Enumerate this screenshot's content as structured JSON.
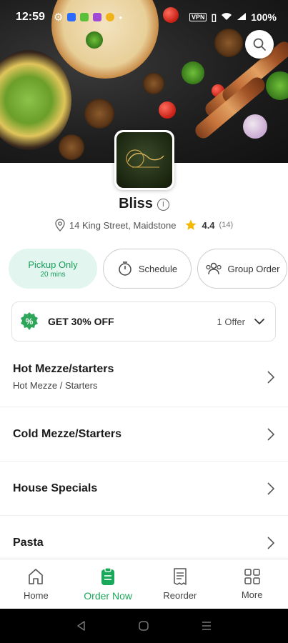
{
  "status_bar": {
    "time": "12:59",
    "battery": "100%",
    "vpn": "VPN"
  },
  "restaurant": {
    "name": "Bliss",
    "info_glyph": "i",
    "address": "14 King Street, Maidstone",
    "rating": "4.4",
    "review_count": "(14)"
  },
  "chips": {
    "pickup_label": "Pickup Only",
    "pickup_time": "20 mins",
    "schedule_label": "Schedule",
    "group_label": "Group Order"
  },
  "offer": {
    "title": "GET 30% OFF",
    "count": "1 Offer",
    "badge": "%"
  },
  "menu": [
    {
      "title": "Hot Mezze/starters",
      "subtitle": "Hot Mezze / Starters"
    },
    {
      "title": "Cold Mezze/Starters",
      "subtitle": ""
    },
    {
      "title": "House Specials",
      "subtitle": ""
    },
    {
      "title": "Pasta",
      "subtitle": ""
    }
  ],
  "bottom_nav": [
    {
      "label": "Home",
      "icon": "home-icon"
    },
    {
      "label": "Order Now",
      "icon": "order-icon"
    },
    {
      "label": "Reorder",
      "icon": "receipt-icon"
    },
    {
      "label": "More",
      "icon": "grid-icon"
    }
  ],
  "colors": {
    "accent": "#1aa85a",
    "pickup_bg": "#e3f5ef",
    "star": "#f5b800",
    "badge": "#2ea65a"
  }
}
